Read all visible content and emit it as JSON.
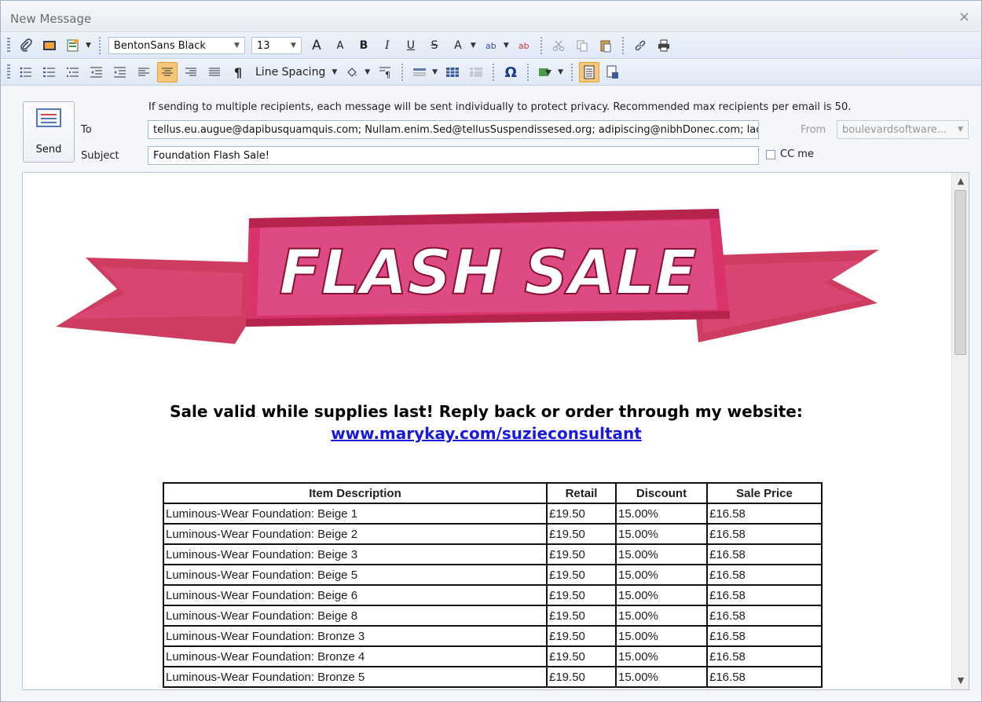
{
  "window": {
    "title": "New Message",
    "close_glyph": "×"
  },
  "toolbar1": {
    "font": "BentonSans Black",
    "size": "13",
    "bold": "B",
    "italic": "I",
    "underline": "U",
    "strike": "S",
    "font_color": "A",
    "grow_font": "A",
    "shrink_font": "A",
    "highlight": "ab",
    "clear_format": "ab"
  },
  "toolbar2": {
    "line_spacing": "Line Spacing",
    "paragraph_mark": "¶",
    "omega": "Ω"
  },
  "compose": {
    "notice": "If sending to multiple recipients, each message will be sent individually to protect privacy. Recommended max recipients per email is 50.",
    "send_label": "Send",
    "to_label": "To",
    "to_value": "tellus.eu.augue@dapibusquamquis.com; Nullam.enim.Sed@tellusSuspendissesed.org; adipiscing@nibhDonec.com; lacus",
    "from_label": "From",
    "from_value": "boulevardsoftware...",
    "subject_label": "Subject",
    "subject_value": "Foundation Flash Sale!",
    "cc_label": "CC me"
  },
  "body": {
    "banner_text": "FLASH SALE",
    "line1": "Sale valid while supplies last! Reply back or order through my website:",
    "link": "www.marykay.com/suzieconsultant",
    "table": {
      "headers": [
        "Item Description",
        "Retail",
        "Discount",
        "Sale Price"
      ],
      "rows": [
        [
          "Luminous-Wear Foundation: Beige 1",
          "£19.50",
          "15.00%",
          "£16.58"
        ],
        [
          "Luminous-Wear Foundation: Beige 2",
          "£19.50",
          "15.00%",
          "£16.58"
        ],
        [
          "Luminous-Wear Foundation: Beige 3",
          "£19.50",
          "15.00%",
          "£16.58"
        ],
        [
          "Luminous-Wear Foundation: Beige 5",
          "£19.50",
          "15.00%",
          "£16.58"
        ],
        [
          "Luminous-Wear Foundation: Beige 6",
          "£19.50",
          "15.00%",
          "£16.58"
        ],
        [
          "Luminous-Wear Foundation: Beige 8",
          "£19.50",
          "15.00%",
          "£16.58"
        ],
        [
          "Luminous-Wear Foundation: Bronze 3",
          "£19.50",
          "15.00%",
          "£16.58"
        ],
        [
          "Luminous-Wear Foundation: Bronze 4",
          "£19.50",
          "15.00%",
          "£16.58"
        ],
        [
          "Luminous-Wear Foundation: Bronze 5",
          "£19.50",
          "15.00%",
          "£16.58"
        ]
      ]
    }
  },
  "colors": {
    "accent_active": "#f7c779",
    "banner": "#d8336b",
    "link": "#1a1adc"
  }
}
